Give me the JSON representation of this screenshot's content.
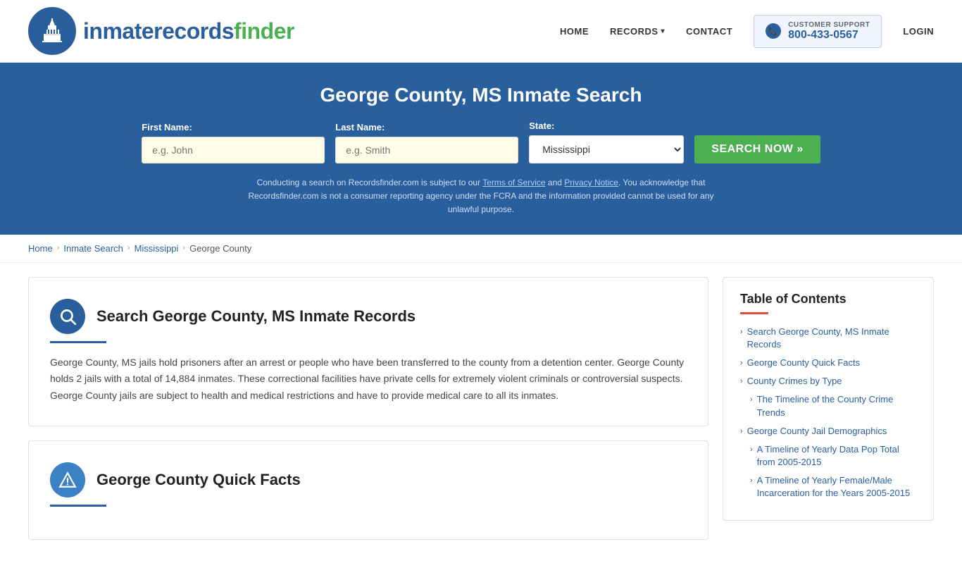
{
  "header": {
    "logo_text_main": "inmaterecords",
    "logo_text_bold": "finder",
    "nav": {
      "home": "HOME",
      "records": "RECORDS",
      "contact": "CONTACT",
      "login": "LOGIN"
    },
    "support": {
      "label": "CUSTOMER SUPPORT",
      "phone": "800-433-0567"
    }
  },
  "hero": {
    "title": "George County, MS Inmate Search",
    "form": {
      "first_name_label": "First Name:",
      "first_name_placeholder": "e.g. John",
      "last_name_label": "Last Name:",
      "last_name_placeholder": "e.g. Smith",
      "state_label": "State:",
      "state_value": "Mississippi",
      "search_button": "SEARCH NOW »"
    },
    "disclaimer": "Conducting a search on Recordsfinder.com is subject to our Terms of Service and Privacy Notice. You acknowledge that Recordsfinder.com is not a consumer reporting agency under the FCRA and the information provided cannot be used for any unlawful purpose."
  },
  "breadcrumb": {
    "home": "Home",
    "inmate_search": "Inmate Search",
    "state": "Mississippi",
    "county": "George County"
  },
  "main_section": {
    "search_section": {
      "title": "Search George County, MS Inmate Records",
      "body": "George County, MS jails hold prisoners after an arrest or people who have been transferred to the county from a detention center. George County holds 2 jails with a total of 14,884 inmates. These correctional facilities have private cells for extremely violent criminals or controversial suspects. George County jails are subject to health and medical restrictions and have to provide medical care to all its inmates."
    },
    "quick_facts_section": {
      "title": "George County Quick Facts"
    }
  },
  "toc": {
    "title": "Table of Contents",
    "items": [
      {
        "label": "Search George County, MS Inmate Records",
        "sub": false
      },
      {
        "label": "George County Quick Facts",
        "sub": false
      },
      {
        "label": "County Crimes by Type",
        "sub": false
      },
      {
        "label": "The Timeline of the County Crime Trends",
        "sub": true
      },
      {
        "label": "George County Jail Demographics",
        "sub": false
      },
      {
        "label": "A Timeline of Yearly Data Pop Total from 2005-2015",
        "sub": true
      },
      {
        "label": "A Timeline of Yearly Female/Male Incarceration for the Years 2005-2015",
        "sub": true
      }
    ]
  }
}
